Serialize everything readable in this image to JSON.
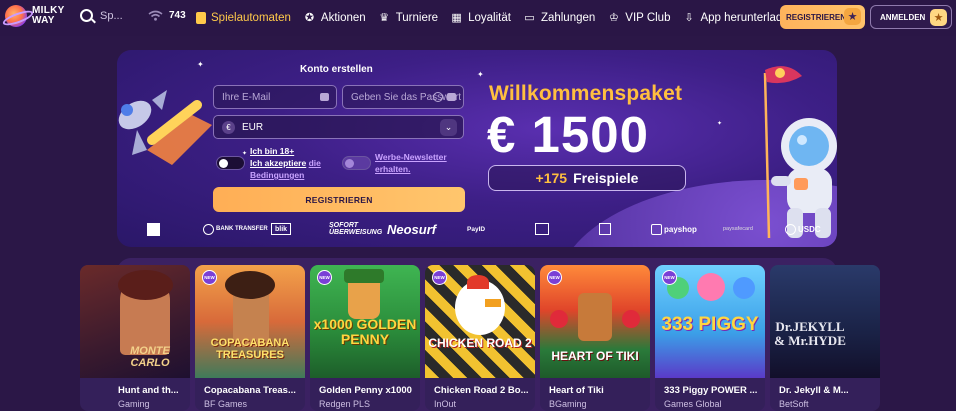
{
  "header": {
    "logo": {
      "line1": "MILKY",
      "line2": "WAY"
    },
    "search_placeholder": "Sp...",
    "online_count": "743",
    "nav": [
      {
        "label": "Spielautomaten",
        "icon": "slot-machine-icon",
        "active": true
      },
      {
        "label": "Aktionen",
        "icon": "gift-icon"
      },
      {
        "label": "Turniere",
        "icon": "trophy-icon"
      },
      {
        "label": "Loyalität",
        "icon": "loyalty-card-icon"
      },
      {
        "label": "Zahlungen",
        "icon": "wallet-icon"
      },
      {
        "label": "VIP Club",
        "icon": "crown-icon"
      },
      {
        "label": "App herunterladen",
        "icon": "download-icon"
      }
    ],
    "register_label": "REGISTRIEREN",
    "login_label": "ANMELDEN"
  },
  "hero": {
    "form": {
      "title": "Konto erstellen",
      "email_placeholder": "Ihre E-Mail",
      "password_placeholder": "Geben Sie das Passwort",
      "currency": "EUR",
      "currency_symbol": "€",
      "terms_prefix": "Ich bin 18+",
      "terms_middle": "Ich akzeptiere",
      "terms_link1": "die",
      "terms_link2": "Bedingungen",
      "newsletter": "Werbe-Newsletter erhalten.",
      "submit_label": "REGISTRIEREN"
    },
    "promo": {
      "title": "Willkommenspaket",
      "amount": "€ 1500",
      "spins_count": "+175",
      "spins_label": "Freispiele"
    },
    "payment_methods": [
      "BANK TRANSFER",
      "blik",
      "SOFORT ÜBERWEISUNG",
      "Neosurf",
      "PayID",
      "paysafecard",
      "payshop",
      "USDC"
    ]
  },
  "games": [
    {
      "name": "Hunt and th...",
      "provider": "Gaming",
      "art_title": "MONTE CARLO",
      "new": false
    },
    {
      "name": "Copacabana Treas...",
      "provider": "BF Games",
      "art_title": "COPACABANA TREASURES",
      "new": true
    },
    {
      "name": "Golden Penny x1000",
      "provider": "Redgen PLS",
      "art_title": "x1000 GOLDEN PENNY",
      "new": true
    },
    {
      "name": "Chicken Road 2 Bo...",
      "provider": "InOut",
      "art_title": "CHICKEN ROAD 2",
      "new": true
    },
    {
      "name": "Heart of Tiki",
      "provider": "BGaming",
      "art_title": "HEART OF TIKI",
      "new": true
    },
    {
      "name": "333 Piggy POWER ...",
      "provider": "Games Global",
      "art_title": "333 PIGGY",
      "new": true
    },
    {
      "name": "Dr. Jekyll & M...",
      "provider": "BetSoft",
      "art_title": "Dr.JEKYLL & Mr.HYDE",
      "new": false
    }
  ],
  "colors": {
    "accent": "#ffbf3f",
    "background": "#2b1747",
    "banner": "#3d1f86"
  }
}
